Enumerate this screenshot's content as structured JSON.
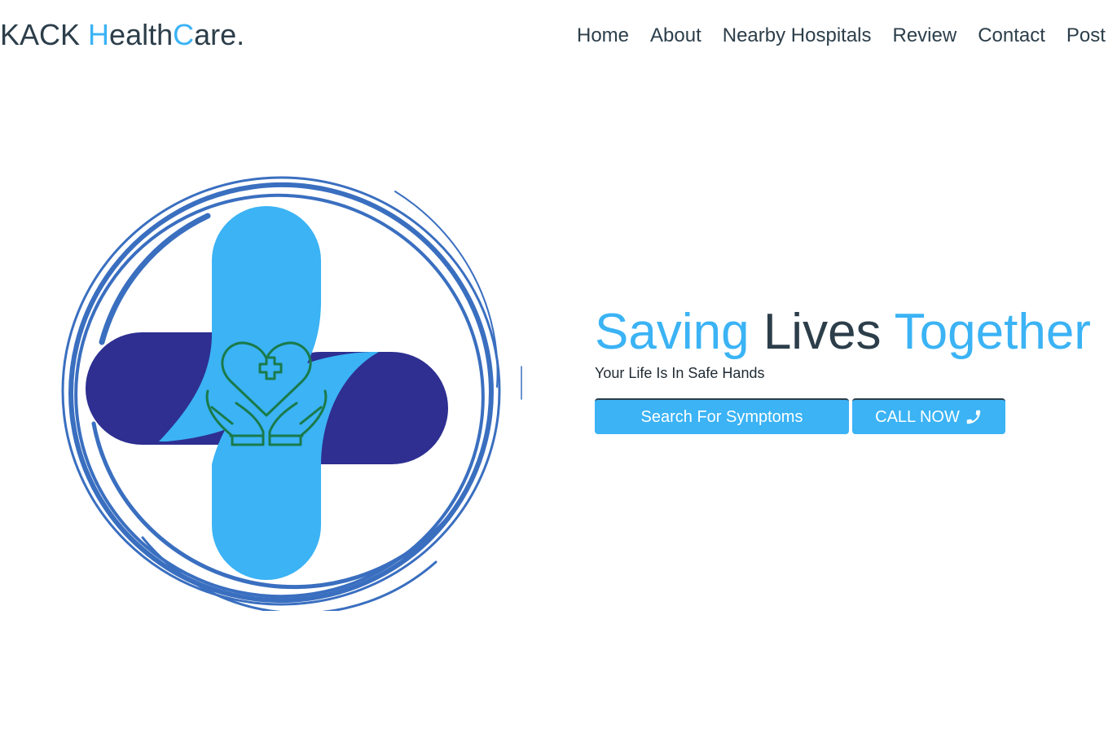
{
  "brand": {
    "part1": "KACK ",
    "part2": "H",
    "part3": "ealth",
    "part4": "C",
    "part5": "are."
  },
  "nav": {
    "items": [
      {
        "label": "Home"
      },
      {
        "label": "About"
      },
      {
        "label": "Nearby Hospitals"
      },
      {
        "label": "Review"
      },
      {
        "label": "Contact"
      },
      {
        "label": "Post"
      }
    ]
  },
  "hero": {
    "title_word1": "Saving",
    "title_word2": "Lives",
    "title_word3": "Together",
    "subtitle": "Your Life Is In Safe Hands",
    "search_button": "Search For Symptoms",
    "call_button": "CALL NOW",
    "call_icon": "phone-icon"
  },
  "logo": {
    "icon": "medical-cross-heart-hands-logo"
  },
  "colors": {
    "accent": "#3bb3f5",
    "dark_text": "#2c3e4a",
    "logo_navy": "#2e2f91",
    "logo_ring": "#3a6fc0",
    "logo_green": "#1a7a4a"
  }
}
